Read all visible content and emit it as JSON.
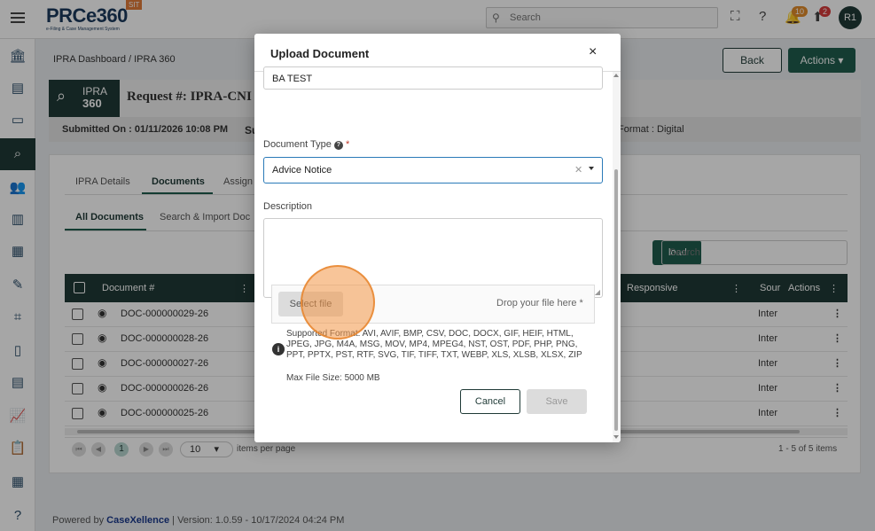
{
  "app": {
    "logo_text": "PRCe360",
    "logo_subtitle": "e-Filing & Case Management System",
    "env_badge": "SIT",
    "search_placeholder": "Search",
    "notifications_count": "10",
    "uploads_count": "2",
    "avatar_initials": "R1"
  },
  "page": {
    "breadcrumb": "IPRA Dashboard / IPRA 360",
    "back_label": "Back",
    "actions_label": "Actions ▾",
    "ipra_label_top": "IPRA",
    "ipra_label_bottom": "360",
    "request_title": "Request #: IPRA-CNI",
    "submitted_on": "Submitted On : 01/11/2026 10:08 PM",
    "submitted_extra": "Su",
    "format": "Format : Digital",
    "tabs": [
      "IPRA Details",
      "Documents",
      "Assign"
    ],
    "subtabs": [
      "All Documents",
      "Search & Import Doc"
    ],
    "upload_label": "load",
    "table_search_placeholder": "Search",
    "columns": {
      "document": "Document #",
      "responsive": "Responsive",
      "source": "Sour",
      "actions": "Actions"
    },
    "rows": [
      {
        "doc": "DOC-000000029-26",
        "source": "Inter"
      },
      {
        "doc": "DOC-000000028-26",
        "source": "Inter"
      },
      {
        "doc": "DOC-000000027-26",
        "source": "Inter"
      },
      {
        "doc": "DOC-000000026-26",
        "source": "Inter"
      },
      {
        "doc": "DOC-000000025-26",
        "source": "Inter"
      }
    ],
    "pager": {
      "current": "1",
      "per_page": "10",
      "per_page_label": "items per page",
      "summary": "1 - 5 of 5 items"
    },
    "footer": {
      "powered": "Powered by",
      "brand": "CaseXellence",
      "version": "|  Version: 1.0.59 - 10/17/2024 04:24 PM"
    }
  },
  "modal": {
    "title": "Upload Document",
    "close": "×",
    "top_field_value": "BA TEST",
    "doc_type_label": "Document Type",
    "doc_type_value": "Advice Notice",
    "description_label": "Description",
    "select_file_label": "Select file",
    "drop_hint": "Drop your file here *",
    "supported_formats": "Supported Format: AVI, AVIF, BMP, CSV, DOC, DOCX, GIF, HEIF, HTML, JPEG, JPG, M4A, MSG, MOV, MP4, MPEG4, NST, OST, PDF, PHP, PNG, PPT, PPTX, PST, RTF, SVG, TIF, TIFF, TXT, WEBP, XLS, XLSB, XLSX, ZIP",
    "max_size": "Max File Size: 5000 MB",
    "cancel_label": "Cancel",
    "save_label": "Save"
  },
  "colors": {
    "primary": "#1f3a36",
    "accent": "#1f5c4e",
    "click_marker": "#f39646"
  }
}
